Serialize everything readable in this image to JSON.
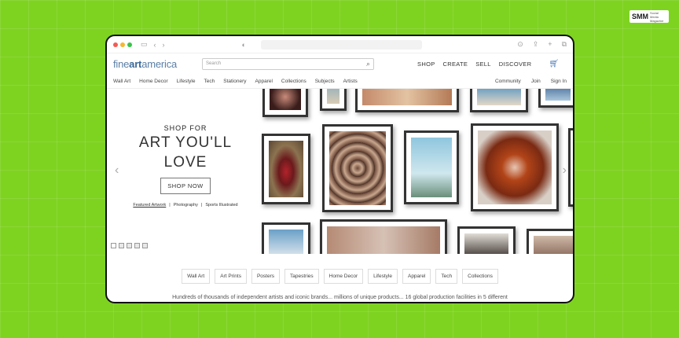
{
  "badge": {
    "brand": "SMM",
    "tagline": "Social Media Magazine"
  },
  "site": {
    "logo_prefix": "fine",
    "logo_bold": "art",
    "logo_suffix": "america",
    "search_placeholder": "Search",
    "main_nav": [
      "SHOP",
      "CREATE",
      "SELL",
      "DISCOVER"
    ],
    "sub_nav_left": [
      "Wall Art",
      "Home Decor",
      "Lifestyle",
      "Tech",
      "Stationery",
      "Apparel",
      "Collections",
      "Subjects",
      "Artists"
    ],
    "sub_nav_right": [
      "Community",
      "Join",
      "Sign In"
    ]
  },
  "hero": {
    "kicker": "SHOP FOR",
    "title_line1": "ART YOU'LL",
    "title_line2": "LOVE",
    "button": "SHOP NOW",
    "link1": "Featured Artwork",
    "link2": "Photography",
    "link3": "Sports Illustrated",
    "separator": "|"
  },
  "categories": [
    "Wall Art",
    "Art Prints",
    "Posters",
    "Tapestries",
    "Home Decor",
    "Lifestyle",
    "Apparel",
    "Tech",
    "Collections"
  ],
  "tagline": "Hundreds of thousands of independent artists and iconic brands... millions of unique products... 16 global production facilities in 5 different",
  "colors": {
    "background": "#7ed321",
    "accent": "#4a7ab5"
  }
}
